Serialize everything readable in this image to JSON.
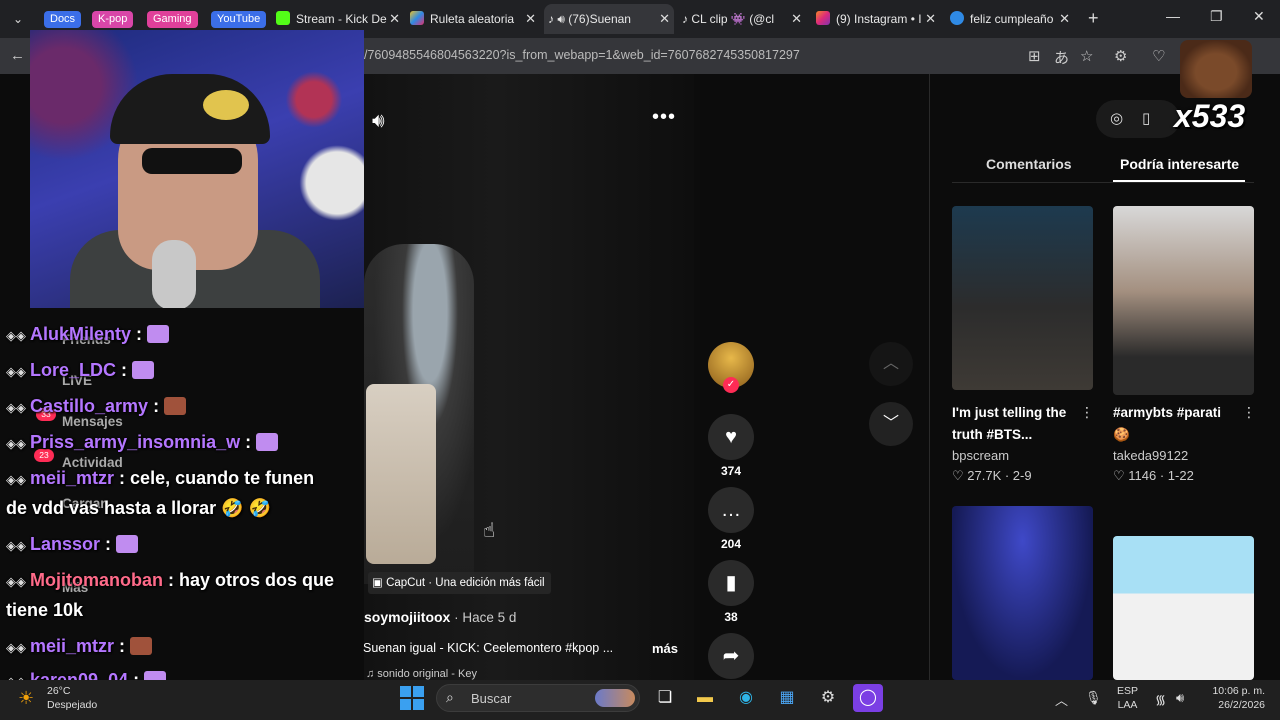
{
  "tabs": {
    "groups": [
      {
        "label": "Docs",
        "color": "#3b6ee8"
      },
      {
        "label": "K-pop",
        "color": "#d946a8"
      },
      {
        "label": "Gaming",
        "color": "#e0409a"
      },
      {
        "label": "YouTube",
        "color": "#3b6ee8"
      }
    ],
    "items": [
      {
        "label": "Stream - Kick De",
        "color": "#53fc18"
      },
      {
        "label": "Ruleta aleatoria",
        "color": "#e8c12e"
      },
      {
        "label": "(76)Suenan",
        "color": "#ffffff"
      },
      {
        "label": "CL clip 👾 (@cl",
        "color": "#ffffff"
      },
      {
        "label": "(9) Instagram • I",
        "color": "#e1306c"
      },
      {
        "label": "feliz cumpleaño",
        "color": "#2f8ae5"
      }
    ]
  },
  "address": {
    "url": "/7609485546804563220?is_from_webapp=1&web_id=7607682745350817297"
  },
  "video": {
    "capcut": "CapCut · Una edición más fácil",
    "author": "soymojiitoox",
    "ago": " · Hace 5 d",
    "caption": "Suenan igual - KICK: Ceelemontero #kpop ...",
    "more": "más",
    "sound": "♫ sonido original - Key",
    "likes": "374",
    "comments": "204",
    "saves": "38"
  },
  "sidebar": {
    "tab_comments": "Comentarios",
    "tab_related": "Podría interesarte",
    "cards": [
      {
        "title": "I'm just telling the truth #BTS...",
        "user": "bpscream",
        "stats": "♡ 27.7K · 2-9"
      },
      {
        "title": "#armybts #parati 🍪",
        "user": "takeda99122",
        "stats": "♡ 1146 · 1-22"
      }
    ]
  },
  "overlay": {
    "multiplier": "x533",
    "ghost_nav": [
      "Friends",
      "LIVE",
      "Mensajes",
      "Actividad",
      "Cargar",
      "Más"
    ],
    "badge_counts": [
      "33",
      "23"
    ]
  },
  "chat": [
    {
      "user": "AlukMilenty",
      "text": " : ",
      "color": "#b476ff",
      "emote": "#c08cf0"
    },
    {
      "user": "Lore_LDC",
      "text": " : ",
      "color": "#b476ff",
      "emote": "#c08cf0"
    },
    {
      "user": "Castillo_army",
      "text": " : ",
      "color": "#b476ff",
      "emote": "#a0523b"
    },
    {
      "user": "Priss_army_insomnia_w",
      "text": " : ",
      "color": "#b476ff",
      "emote": "#c08cf0"
    },
    {
      "user": "meii_mtzr",
      "text": " : cele, cuando te funen",
      "color": "#b476ff",
      "emote": ""
    },
    {
      "user": "",
      "text": "de vdd vas hasta a llorar 🤣 🤣",
      "color": "#ffffff",
      "emote": ""
    },
    {
      "user": "Lanssor",
      "text": " : ",
      "color": "#b476ff",
      "emote": "#c08cf0"
    },
    {
      "user": "Mojitomanoban",
      "text": " : hay otros dos que",
      "color": "#ff6b8a",
      "emote": ""
    },
    {
      "user": "",
      "text": "tiene 10k",
      "color": "#ffffff",
      "emote": ""
    },
    {
      "user": "meii_mtzr",
      "text": " : ",
      "color": "#b476ff",
      "emote": "#a0523b"
    },
    {
      "user": "karen09_04",
      "text": " : ",
      "color": "#b476ff",
      "emote": "#c08cf0"
    }
  ],
  "taskbar": {
    "temp": "26°C",
    "weather": "Despejado",
    "search": "Buscar",
    "lang1": "ESP",
    "lang2": "LAA",
    "time": "10:06 p. m.",
    "date": "26/2/2026"
  }
}
